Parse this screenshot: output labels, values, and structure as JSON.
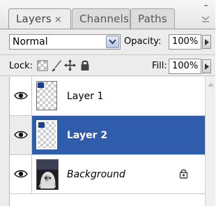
{
  "panel": {
    "tabs": [
      {
        "label": "Layers",
        "close": "×",
        "active": true
      },
      {
        "label": "Channels",
        "active": false
      },
      {
        "label": "Paths",
        "active": false
      }
    ],
    "menu_icon": "panel-menu-icon"
  },
  "blend": {
    "value": "Normal"
  },
  "opacity": {
    "label": "Opacity:",
    "value": "100%"
  },
  "lock": {
    "label": "Lock:",
    "icons": [
      "lock-transparent-icon",
      "lock-image-icon",
      "lock-position-icon",
      "lock-all-icon"
    ]
  },
  "fill": {
    "label": "Fill:",
    "value": "100%"
  },
  "layers": [
    {
      "name": "Layer 1",
      "selected": false,
      "visible_icon": "eye-icon"
    },
    {
      "name": "Layer 2",
      "selected": true,
      "visible_icon": "eye-icon"
    },
    {
      "name": "Background",
      "selected": false,
      "locked": true,
      "visible_icon": "eye-icon"
    }
  ],
  "colors": {
    "selection": "#2f5cab",
    "panel_bg": "#ececec"
  }
}
